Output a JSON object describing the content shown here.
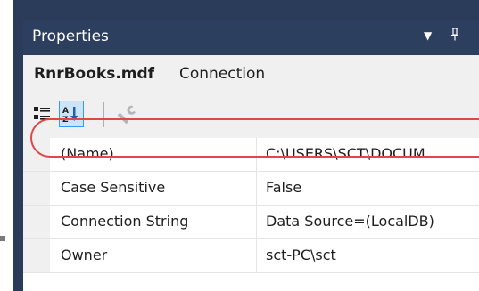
{
  "panel": {
    "title": "Properties",
    "dropdown_icon": "▼",
    "pin_icon": "📌"
  },
  "object": {
    "name": "RnrBooks.mdf",
    "type": "Connection"
  },
  "toolbar": {
    "categorized": "categorized-icon",
    "alphabetical": "alphabetical-icon",
    "property_pages": "wrench-icon"
  },
  "properties": [
    {
      "name": "(Name)",
      "value": "C:\\USERS\\SCT\\DOCUM"
    },
    {
      "name": "Case Sensitive",
      "value": "False"
    },
    {
      "name": "Connection String",
      "value": "Data Source=(LocalDB)"
    },
    {
      "name": "Owner",
      "value": "sct-PC\\sct"
    }
  ],
  "colors": {
    "titlebar": "#2d3f5f",
    "highlight": "#e04848",
    "selected_button": "#cce4f7"
  }
}
